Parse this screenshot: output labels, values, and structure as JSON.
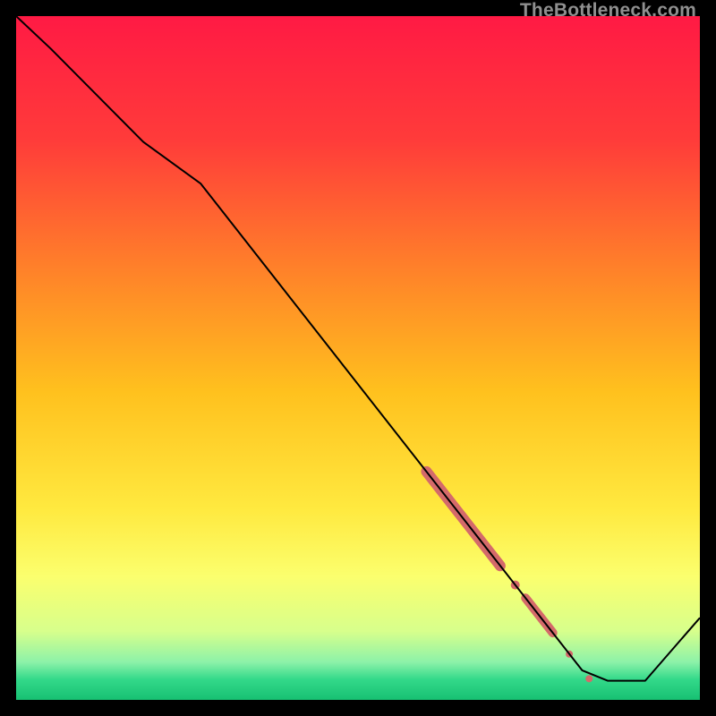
{
  "watermark": "TheBottleneck.com",
  "chart_data": {
    "type": "line",
    "title": "",
    "xlabel": "",
    "ylabel": "",
    "xlim": [
      0,
      100
    ],
    "ylim": [
      0,
      100
    ],
    "background_gradient": {
      "stops": [
        {
          "offset": 0.0,
          "color": "#ff1a44"
        },
        {
          "offset": 0.18,
          "color": "#ff3b3a"
        },
        {
          "offset": 0.4,
          "color": "#ff8c27"
        },
        {
          "offset": 0.55,
          "color": "#ffc11e"
        },
        {
          "offset": 0.72,
          "color": "#ffe93f"
        },
        {
          "offset": 0.82,
          "color": "#fbff6e"
        },
        {
          "offset": 0.9,
          "color": "#d7ff8c"
        },
        {
          "offset": 0.945,
          "color": "#8cf2a9"
        },
        {
          "offset": 0.97,
          "color": "#33d98a"
        },
        {
          "offset": 1.0,
          "color": "#17c072"
        }
      ]
    },
    "series": [
      {
        "name": "curve",
        "stroke": "#000000",
        "stroke_width": 2,
        "points": [
          {
            "x": 0.0,
            "y": 100.0
          },
          {
            "x": 5.1,
            "y": 95.2
          },
          {
            "x": 18.6,
            "y": 81.6
          },
          {
            "x": 27.0,
            "y": 75.5
          },
          {
            "x": 82.8,
            "y": 4.3
          },
          {
            "x": 86.5,
            "y": 2.8
          },
          {
            "x": 92.0,
            "y": 2.8
          },
          {
            "x": 100.0,
            "y": 12.0
          }
        ]
      }
    ],
    "marker_groups": [
      {
        "name": "thick-segment-1",
        "color": "#d46a6a",
        "width": 12,
        "from": {
          "x": 60.0,
          "y": 33.4
        },
        "to": {
          "x": 70.8,
          "y": 19.6
        }
      },
      {
        "name": "dot-1",
        "color": "#d46a6a",
        "radius": 5,
        "at": {
          "x": 73.0,
          "y": 16.8
        }
      },
      {
        "name": "thick-segment-2",
        "color": "#d46a6a",
        "width": 10,
        "from": {
          "x": 74.5,
          "y": 14.9
        },
        "to": {
          "x": 78.5,
          "y": 9.8
        }
      },
      {
        "name": "dot-2",
        "color": "#d46a6a",
        "radius": 4,
        "at": {
          "x": 80.9,
          "y": 6.7
        }
      },
      {
        "name": "dot-3",
        "color": "#d46a6a",
        "radius": 4,
        "at": {
          "x": 83.8,
          "y": 3.1
        }
      }
    ]
  }
}
